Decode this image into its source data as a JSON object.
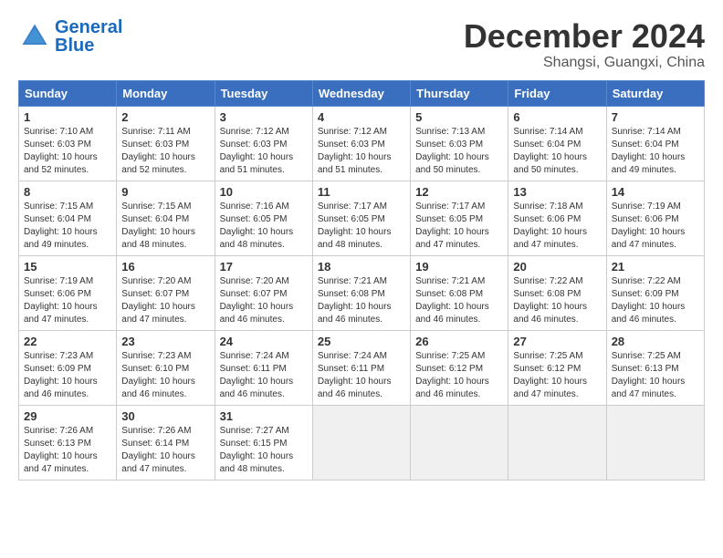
{
  "logo": {
    "line1": "General",
    "line2": "Blue"
  },
  "title": "December 2024",
  "location": "Shangsi, Guangxi, China",
  "weekdays": [
    "Sunday",
    "Monday",
    "Tuesday",
    "Wednesday",
    "Thursday",
    "Friday",
    "Saturday"
  ],
  "days": [
    {
      "num": "",
      "info": ""
    },
    {
      "num": "",
      "info": ""
    },
    {
      "num": "",
      "info": ""
    },
    {
      "num": "",
      "info": ""
    },
    {
      "num": "",
      "info": ""
    },
    {
      "num": "",
      "info": ""
    },
    {
      "num": "1",
      "sunrise": "7:10 AM",
      "sunset": "6:03 PM",
      "daylight": "10 hours and 52 minutes."
    },
    {
      "num": "2",
      "sunrise": "7:11 AM",
      "sunset": "6:03 PM",
      "daylight": "10 hours and 52 minutes."
    },
    {
      "num": "3",
      "sunrise": "7:12 AM",
      "sunset": "6:03 PM",
      "daylight": "10 hours and 51 minutes."
    },
    {
      "num": "4",
      "sunrise": "7:12 AM",
      "sunset": "6:03 PM",
      "daylight": "10 hours and 51 minutes."
    },
    {
      "num": "5",
      "sunrise": "7:13 AM",
      "sunset": "6:03 PM",
      "daylight": "10 hours and 50 minutes."
    },
    {
      "num": "6",
      "sunrise": "7:14 AM",
      "sunset": "6:04 PM",
      "daylight": "10 hours and 50 minutes."
    },
    {
      "num": "7",
      "sunrise": "7:14 AM",
      "sunset": "6:04 PM",
      "daylight": "10 hours and 49 minutes."
    },
    {
      "num": "8",
      "sunrise": "7:15 AM",
      "sunset": "6:04 PM",
      "daylight": "10 hours and 49 minutes."
    },
    {
      "num": "9",
      "sunrise": "7:15 AM",
      "sunset": "6:04 PM",
      "daylight": "10 hours and 48 minutes."
    },
    {
      "num": "10",
      "sunrise": "7:16 AM",
      "sunset": "6:05 PM",
      "daylight": "10 hours and 48 minutes."
    },
    {
      "num": "11",
      "sunrise": "7:17 AM",
      "sunset": "6:05 PM",
      "daylight": "10 hours and 48 minutes."
    },
    {
      "num": "12",
      "sunrise": "7:17 AM",
      "sunset": "6:05 PM",
      "daylight": "10 hours and 47 minutes."
    },
    {
      "num": "13",
      "sunrise": "7:18 AM",
      "sunset": "6:06 PM",
      "daylight": "10 hours and 47 minutes."
    },
    {
      "num": "14",
      "sunrise": "7:19 AM",
      "sunset": "6:06 PM",
      "daylight": "10 hours and 47 minutes."
    },
    {
      "num": "15",
      "sunrise": "7:19 AM",
      "sunset": "6:06 PM",
      "daylight": "10 hours and 47 minutes."
    },
    {
      "num": "16",
      "sunrise": "7:20 AM",
      "sunset": "6:07 PM",
      "daylight": "10 hours and 47 minutes."
    },
    {
      "num": "17",
      "sunrise": "7:20 AM",
      "sunset": "6:07 PM",
      "daylight": "10 hours and 46 minutes."
    },
    {
      "num": "18",
      "sunrise": "7:21 AM",
      "sunset": "6:08 PM",
      "daylight": "10 hours and 46 minutes."
    },
    {
      "num": "19",
      "sunrise": "7:21 AM",
      "sunset": "6:08 PM",
      "daylight": "10 hours and 46 minutes."
    },
    {
      "num": "20",
      "sunrise": "7:22 AM",
      "sunset": "6:08 PM",
      "daylight": "10 hours and 46 minutes."
    },
    {
      "num": "21",
      "sunrise": "7:22 AM",
      "sunset": "6:09 PM",
      "daylight": "10 hours and 46 minutes."
    },
    {
      "num": "22",
      "sunrise": "7:23 AM",
      "sunset": "6:09 PM",
      "daylight": "10 hours and 46 minutes."
    },
    {
      "num": "23",
      "sunrise": "7:23 AM",
      "sunset": "6:10 PM",
      "daylight": "10 hours and 46 minutes."
    },
    {
      "num": "24",
      "sunrise": "7:24 AM",
      "sunset": "6:11 PM",
      "daylight": "10 hours and 46 minutes."
    },
    {
      "num": "25",
      "sunrise": "7:24 AM",
      "sunset": "6:11 PM",
      "daylight": "10 hours and 46 minutes."
    },
    {
      "num": "26",
      "sunrise": "7:25 AM",
      "sunset": "6:12 PM",
      "daylight": "10 hours and 46 minutes."
    },
    {
      "num": "27",
      "sunrise": "7:25 AM",
      "sunset": "6:12 PM",
      "daylight": "10 hours and 47 minutes."
    },
    {
      "num": "28",
      "sunrise": "7:25 AM",
      "sunset": "6:13 PM",
      "daylight": "10 hours and 47 minutes."
    },
    {
      "num": "29",
      "sunrise": "7:26 AM",
      "sunset": "6:13 PM",
      "daylight": "10 hours and 47 minutes."
    },
    {
      "num": "30",
      "sunrise": "7:26 AM",
      "sunset": "6:14 PM",
      "daylight": "10 hours and 47 minutes."
    },
    {
      "num": "31",
      "sunrise": "7:27 AM",
      "sunset": "6:15 PM",
      "daylight": "10 hours and 48 minutes."
    }
  ]
}
